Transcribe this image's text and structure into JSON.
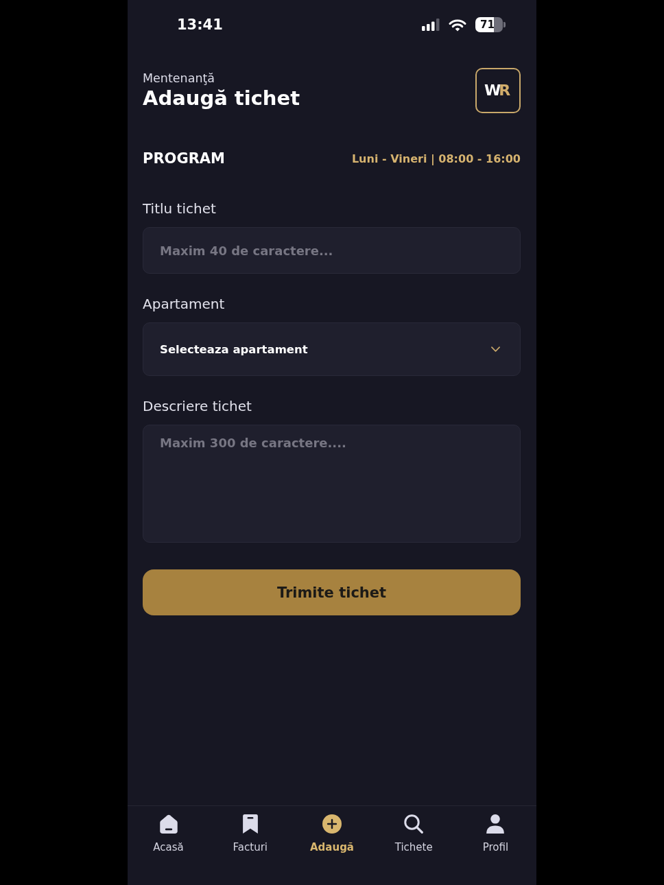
{
  "status_bar": {
    "time": "13:41",
    "battery": "71"
  },
  "header": {
    "subtitle": "Mentenanţă",
    "title": "Adaugă tichet",
    "logo": {
      "letters": [
        {
          "char": "W",
          "accent": false
        },
        {
          "char": "R",
          "accent": true
        }
      ]
    }
  },
  "schedule": {
    "label": "PROGRAM",
    "hours": "Luni - Vineri | 08:00 - 16:00"
  },
  "form": {
    "fields": [
      {
        "kind": "text",
        "label": "Titlu tichet",
        "placeholder": "Maxim 40 de caractere..."
      },
      {
        "kind": "select",
        "label": "Apartament",
        "value": "Selecteaza apartament"
      },
      {
        "kind": "textarea",
        "label": "Descriere tichet",
        "placeholder": "Maxim 300 de caractere...."
      }
    ],
    "submit": "Trimite tichet"
  },
  "tab_bar": [
    {
      "kind": "home",
      "label": "Acasă",
      "selected": false
    },
    {
      "kind": "bookmark",
      "label": "Facturi",
      "selected": false
    },
    {
      "kind": "add",
      "label": "Adaugă",
      "selected": true
    },
    {
      "kind": "search",
      "label": "Tichete",
      "selected": false
    },
    {
      "kind": "profile",
      "label": "Profil",
      "selected": false
    }
  ]
}
